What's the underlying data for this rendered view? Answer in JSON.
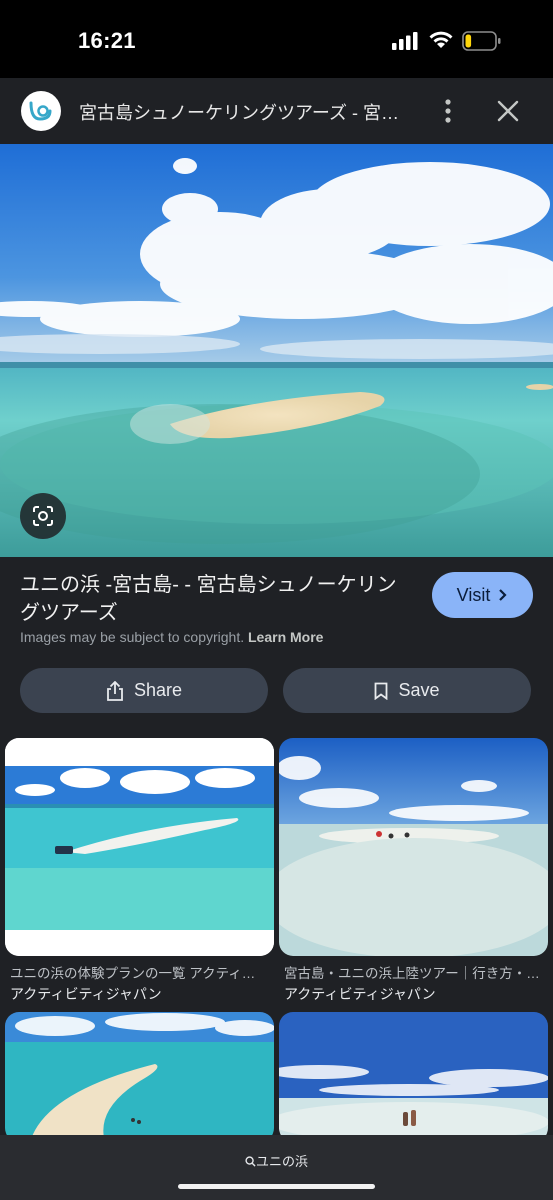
{
  "status_bar": {
    "time": "16:21",
    "battery_level": 0.2,
    "battery_color": "#ffd60a"
  },
  "header": {
    "title": "宮古島シュノーケリングツアーズ - 宮古島シュノーケリングツアーズ",
    "logo_icon": "lens-logo-icon",
    "more_icon": "more-vert-icon",
    "close_icon": "close-icon"
  },
  "result": {
    "title": "ユニの浜 -宮古島- - 宮古島シュノーケリングツアーズ",
    "visit_label": "Visit",
    "copyright_text": "Images may be subject to copyright.",
    "learn_more": "Learn More",
    "share_label": "Share",
    "save_label": "Save",
    "accent_color": "#8ab4f8"
  },
  "related": [
    {
      "caption": "ユニの浜の体験プランの一覧 アクティビティジャパン",
      "source": "アクティビティジャパン"
    },
    {
      "caption": "宮古島・ユニの浜上陸ツアー｜行き方・料金",
      "source": "アクティビティジャパン"
    },
    {
      "caption": "",
      "source": ""
    },
    {
      "caption": "",
      "source": ""
    }
  ],
  "bottom_bar": {
    "query": "ユニの浜",
    "search_icon": "search-icon"
  }
}
